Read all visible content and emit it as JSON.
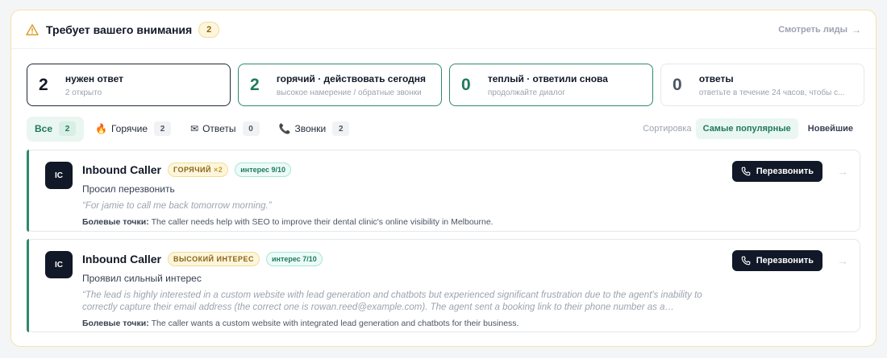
{
  "header": {
    "title": "Требует вашего внимания",
    "count": "2",
    "view_leads": "Смотреть лиды",
    "view_leads_arrow": "→"
  },
  "summary": [
    {
      "num": "2",
      "label": "нужен ответ",
      "sub": "2 открыто"
    },
    {
      "num": "2",
      "label": "горячий · действовать сегодня",
      "sub": "высокое намерение / обратные звонки"
    },
    {
      "num": "0",
      "label": "теплый · ответили снова",
      "sub": "продолжайте диалог"
    },
    {
      "num": "0",
      "label": "ответы",
      "sub": "ответьте в течение 24 часов, чтобы с..."
    }
  ],
  "tabs": [
    {
      "icon": "",
      "label": "Все",
      "count": "2"
    },
    {
      "icon": "🔥",
      "label": "Горячие",
      "count": "2"
    },
    {
      "icon": "✉",
      "label": "Ответы",
      "count": "0"
    },
    {
      "icon": "📞",
      "label": "Звонки",
      "count": "2"
    }
  ],
  "sort": {
    "label": "Сортировка",
    "options": [
      "Самые популярные",
      "Новейшие"
    ]
  },
  "leads": [
    {
      "initials": "IC",
      "name": "Inbound Caller",
      "badge": "ГОРЯЧИЙ",
      "badge_mult": "×2",
      "interest": "интерес 9/10",
      "subtitle": "Просил перезвонить",
      "quote": "“For jamie to call me back tomorrow morning.”",
      "pain_label": "Болевые точки:",
      "pain_text": "The caller needs help with SEO to improve their dental clinic's online visibility in Melbourne.",
      "call_label": "Перезвонить",
      "arrow": "→"
    },
    {
      "initials": "IC",
      "name": "Inbound Caller",
      "badge": "ВЫСОКИЙ ИНТЕРЕС",
      "interest": "интерес 7/10",
      "subtitle": "Проявил сильный интерес",
      "quote": "“The lead is highly interested in a custom website with lead generation and chatbots but experienced significant frustration due to the agent's inability to correctly capture their email address (the correct one is rowan.reed@example.com). The agent sent a booking link to their phone number as a…",
      "pain_label": "Болевые точки:",
      "pain_text": "The caller wants a custom website with integrated lead generation and chatbots for their business.",
      "call_label": "Перезвонить",
      "arrow": "→"
    }
  ],
  "colors": {
    "accent_green": "#1f7a5c",
    "warning": "#d99a1e",
    "dark": "#111827"
  }
}
